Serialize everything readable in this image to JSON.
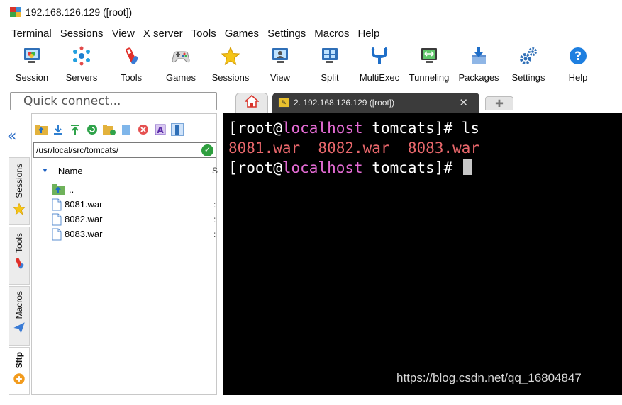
{
  "window": {
    "title": "192.168.126.129 ([root])"
  },
  "menu": [
    "Terminal",
    "Sessions",
    "View",
    "X server",
    "Tools",
    "Games",
    "Settings",
    "Macros",
    "Help"
  ],
  "toolbar": [
    {
      "label": "Session",
      "icon": "session-icon"
    },
    {
      "label": "Servers",
      "icon": "servers-icon"
    },
    {
      "label": "Tools",
      "icon": "tools-icon"
    },
    {
      "label": "Games",
      "icon": "games-icon"
    },
    {
      "label": "Sessions",
      "icon": "star-icon"
    },
    {
      "label": "View",
      "icon": "view-icon"
    },
    {
      "label": "Split",
      "icon": "split-icon"
    },
    {
      "label": "MultiExec",
      "icon": "multiexec-icon"
    },
    {
      "label": "Tunneling",
      "icon": "tunneling-icon"
    },
    {
      "label": "Packages",
      "icon": "packages-icon"
    },
    {
      "label": "Settings",
      "icon": "gears-icon"
    },
    {
      "label": "Help",
      "icon": "help-icon"
    }
  ],
  "quick_connect": {
    "placeholder": "Quick connect..."
  },
  "side_tabs": [
    "Sessions",
    "Tools",
    "Macros",
    "Sftp"
  ],
  "sftp": {
    "path": "/usr/local/src/tomcats/",
    "column_name": "Name",
    "column_next": "S",
    "entries": [
      {
        "name": "..",
        "type": "parent"
      },
      {
        "name": "8081.war",
        "type": "file"
      },
      {
        "name": "8082.war",
        "type": "file"
      },
      {
        "name": "8083.war",
        "type": "file"
      }
    ]
  },
  "tabs": {
    "session_label": "2. 192.168.126.129 ([root])"
  },
  "terminal": {
    "prompt_user": "[root@",
    "prompt_host": "localhost",
    "prompt_dir": " tomcats]# ",
    "command": "ls",
    "output": "8081.war  8082.war  8083.war"
  },
  "watermark": "https://blog.csdn.net/qq_16804847",
  "colors": {
    "terminal_bg": "#000000",
    "host_color": "#e46bd4",
    "file_output_color": "#e8676b",
    "accent_blue": "#1f62c2"
  }
}
